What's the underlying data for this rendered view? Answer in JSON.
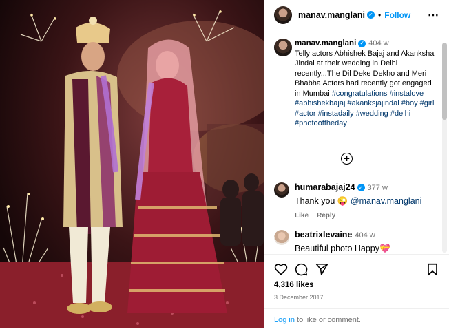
{
  "post": {
    "username": "manav.manglani",
    "dot": "•",
    "follow_label": "Follow",
    "more_icon": "⋯",
    "verified_glyph": "✓"
  },
  "caption": {
    "username": "manav.manglani",
    "time": "404 w",
    "text": "Telly actors Abhishek Bajaj and Akanksha Jindal at their wedding in Delhi recently...The Dil Deke Dekho and Meri Bhabha Actors had recently got engaged in Mumbai",
    "hashtags": [
      "#congratulations",
      "#instalove",
      "#abhishekbajaj",
      "#akanksjajindal",
      "#boy",
      "#girl",
      "#actor",
      "#instadaily",
      "#wedding",
      "#delhi",
      "#photooftheday"
    ]
  },
  "load_more_icon": "+",
  "comments": [
    {
      "username": "humarabajaj24",
      "time": "377 w",
      "text": "Thank you 😜",
      "mention": "@manav.manglani",
      "like_label": "Like",
      "reply_label": "Reply",
      "verified": true
    },
    {
      "username": "beatrixlevaine",
      "time": "404 w",
      "text": "Beautiful photo Happy💝",
      "verified": false
    }
  ],
  "footer": {
    "likes": "4,316 likes",
    "date": "3 December 2017",
    "login_link": "Log in",
    "login_rest": " to like or comment."
  },
  "colors": {
    "accent": "#0095f6",
    "hashtag": "#00376b",
    "muted": "#737373"
  }
}
